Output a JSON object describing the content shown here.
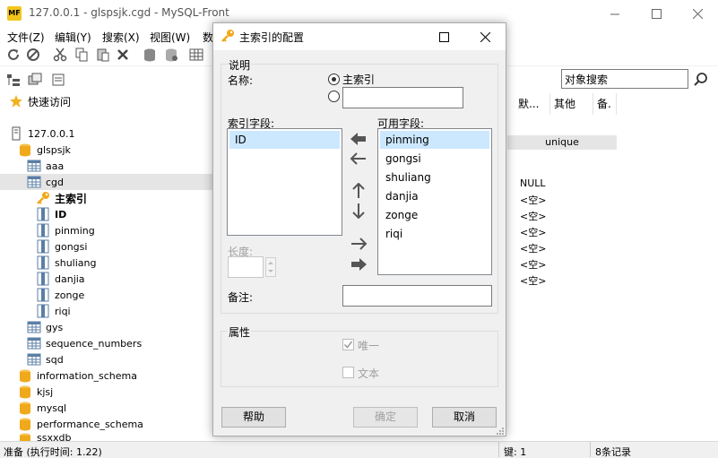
{
  "window": {
    "title": "127.0.0.1 - glspsjk.cgd - MySQL-Front",
    "logo_text": "MF"
  },
  "menu": [
    "文件(Z)",
    "编辑(Y)",
    "搜索(X)",
    "视图(W)",
    "数"
  ],
  "toolbar": {
    "search_placeholder": "对象搜索"
  },
  "sidebar": {
    "quick_access": "快速访问",
    "server": "127.0.0.1",
    "databases": [
      {
        "name": "glspsjk",
        "tables": [
          "aaa",
          "cgd"
        ]
      },
      {
        "name": "information_schema"
      },
      {
        "name": "kjsj"
      },
      {
        "name": "mysql"
      },
      {
        "name": "performance_schema"
      },
      {
        "name": "ssxxdb"
      }
    ],
    "cgd_children": {
      "index": "主索引",
      "fields": [
        "ID",
        "pinming",
        "gongsi",
        "shuliang",
        "danjia",
        "zonge",
        "riqi"
      ]
    },
    "more_tables": [
      "gys",
      "sequence_numbers",
      "sqd"
    ]
  },
  "grid": {
    "headers": [
      "默...",
      "其他",
      "备."
    ],
    "index_type": "unique",
    "values": [
      "NULL",
      "<空>",
      "<空>",
      "<空>",
      "<空>",
      "<空>",
      "<空>"
    ]
  },
  "statusbar": {
    "left": "准备 (执行时间: 1.22)",
    "keys": "键: 1",
    "records": "8条记录"
  },
  "dialog": {
    "title": "主索引的配置",
    "description_group": "说明",
    "name_label": "名称:",
    "radio_primary_label": "主索引",
    "radio_primary_checked": true,
    "custom_name_value": "",
    "index_fields_label": "索引字段:",
    "index_fields": [
      "ID"
    ],
    "available_fields_label": "可用字段:",
    "available_fields": [
      "pinming",
      "gongsi",
      "shuliang",
      "danjia",
      "zonge",
      "riqi"
    ],
    "length_label": "长度:",
    "length_value": "",
    "comment_label": "备注:",
    "comment_value": "",
    "attributes_group": "属性",
    "unique_label": "唯一",
    "unique_checked": true,
    "fulltext_label": "文本",
    "fulltext_checked": false,
    "help_button": "帮助",
    "ok_button": "确定",
    "cancel_button": "取消"
  }
}
